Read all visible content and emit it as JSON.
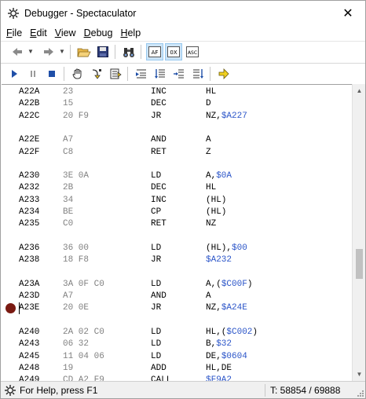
{
  "window": {
    "title": "Debugger - Spectaculator",
    "close_glyph": "✕"
  },
  "menu": [
    {
      "prefix": "",
      "key": "F",
      "rest": "ile"
    },
    {
      "prefix": "",
      "key": "E",
      "rest": "dit"
    },
    {
      "prefix": "",
      "key": "V",
      "rest": "iew"
    },
    {
      "prefix": "",
      "key": "D",
      "rest": "ebug"
    },
    {
      "prefix": "",
      "key": "H",
      "rest": "elp"
    }
  ],
  "toolbar1": {
    "buttons": [
      "back-arrow-icon",
      "forward-arrow-icon",
      "open-folder-icon",
      "save-disk-icon",
      "find-binoculars-icon",
      "show-af-register-icon",
      "show-ascii-hex-icon",
      "show-asc-icon"
    ],
    "labels": {
      "af": "AF",
      "ox": "0X",
      "asc": "ASC"
    }
  },
  "toolbar2": {
    "buttons": [
      "run-icon",
      "pause-icon",
      "stop-icon",
      "hand-icon",
      "step-into-icon",
      "step-over-icon",
      "step-out-icon",
      "run-to-cursor-icon",
      "run-to-return-icon",
      "go-to-address-icon",
      "execute-arrow-icon"
    ]
  },
  "colors": {
    "operand_number": "#2a54c8",
    "bytes": "#808080",
    "breakpoint": "#7a1a12",
    "pressed_bg": "#cce4f7"
  },
  "disassembly": [
    {
      "addr": "A22A",
      "bytes": "23",
      "mnem": "INC",
      "ops": "HL",
      "num": ""
    },
    {
      "addr": "A22B",
      "bytes": "15",
      "mnem": "DEC",
      "ops": "D",
      "num": ""
    },
    {
      "addr": "A22C",
      "bytes": "20 F9",
      "mnem": "JR",
      "ops": "NZ,",
      "num": "$A227"
    },
    {
      "blank": true
    },
    {
      "addr": "A22E",
      "bytes": "A7",
      "mnem": "AND",
      "ops": "A",
      "num": ""
    },
    {
      "addr": "A22F",
      "bytes": "C8",
      "mnem": "RET",
      "ops": "Z",
      "num": ""
    },
    {
      "blank": true
    },
    {
      "addr": "A230",
      "bytes": "3E 0A",
      "mnem": "LD",
      "ops": "A,",
      "num": "$0A"
    },
    {
      "addr": "A232",
      "bytes": "2B",
      "mnem": "DEC",
      "ops": "HL",
      "num": ""
    },
    {
      "addr": "A233",
      "bytes": "34",
      "mnem": "INC",
      "ops": "(HL)",
      "num": ""
    },
    {
      "addr": "A234",
      "bytes": "BE",
      "mnem": "CP",
      "ops": "(HL)",
      "num": ""
    },
    {
      "addr": "A235",
      "bytes": "C0",
      "mnem": "RET",
      "ops": "NZ",
      "num": ""
    },
    {
      "blank": true
    },
    {
      "addr": "A236",
      "bytes": "36 00",
      "mnem": "LD",
      "ops": "(HL),",
      "num": "$00"
    },
    {
      "addr": "A238",
      "bytes": "18 F8",
      "mnem": "JR",
      "ops": "",
      "num": "$A232"
    },
    {
      "blank": true
    },
    {
      "addr": "A23A",
      "bytes": "3A 0F C0",
      "mnem": "LD",
      "ops": "A,(",
      "num": "$C00F",
      "tail": ")"
    },
    {
      "addr": "A23D",
      "bytes": "A7",
      "mnem": "AND",
      "ops": "A",
      "num": ""
    },
    {
      "addr": "A23E",
      "bytes": "20 0E",
      "mnem": "JR",
      "ops": "NZ,",
      "num": "$A24E",
      "breakpoint": true
    },
    {
      "blank": true
    },
    {
      "addr": "A240",
      "bytes": "2A 02 C0",
      "mnem": "LD",
      "ops": "HL,(",
      "num": "$C002",
      "tail": ")"
    },
    {
      "addr": "A243",
      "bytes": "06 32",
      "mnem": "LD",
      "ops": "B,",
      "num": "$32"
    },
    {
      "addr": "A245",
      "bytes": "11 04 06",
      "mnem": "LD",
      "ops": "DE,",
      "num": "$0604"
    },
    {
      "addr": "A248",
      "bytes": "19",
      "mnem": "ADD",
      "ops": "HL,DE",
      "num": ""
    },
    {
      "addr": "A249",
      "bytes": "CD A2 F9",
      "mnem": "CALL",
      "ops": "",
      "num": "$F9A2"
    }
  ],
  "status": {
    "help_text": "For Help, press F1",
    "tstates": "T: 58854 / 69888"
  }
}
